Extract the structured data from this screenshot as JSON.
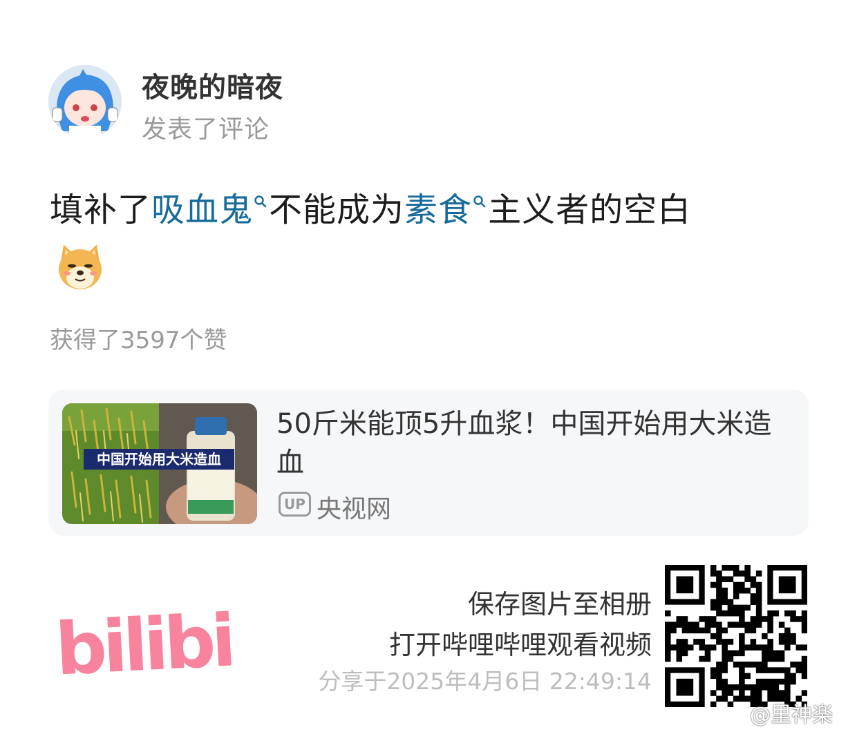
{
  "user": {
    "name": "夜晚的暗夜",
    "action": "发表了评论"
  },
  "comment": {
    "part1": "填补了",
    "link1": "吸血鬼",
    "part2": "不能成为",
    "link2": "素食",
    "part3": "主义者的空白",
    "emoji": "doge-emoji"
  },
  "likes_text": "获得了3597个赞",
  "video_card": {
    "thumbnail_caption": "中国开始用大米造血",
    "title": "50斤米能顶5升血浆！中国开始用大米造血",
    "up_badge": "UP",
    "channel": "央视网"
  },
  "footer": {
    "logo_text": "bilibili",
    "line1": "保存图片至相册",
    "line2": "打开哔哩哔哩观看视频",
    "shared_at": "分享于2025年4月6日 22:49:14",
    "watermark": "@里神楽",
    "brand_color": "#f7839c",
    "link_color": "#176b9b"
  }
}
